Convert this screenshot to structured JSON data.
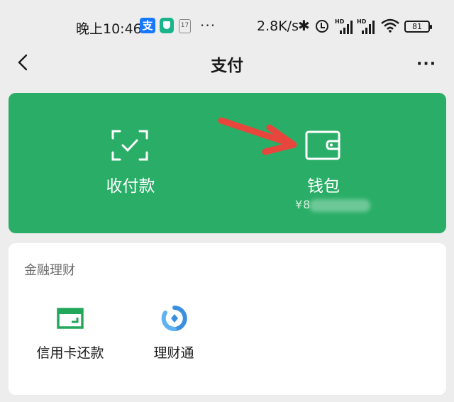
{
  "status_bar": {
    "time": "晚上10:46",
    "alipay_glyph": "支",
    "calendar_day": "17",
    "more_dots": "···",
    "net_speed": "2.8K/s",
    "bluetooth_glyph": "✱",
    "sim1_label": "HD",
    "sim2_label": "HD",
    "battery": "81",
    "icons": [
      "alipay-icon",
      "security-shield-icon",
      "calendar-icon",
      "bluetooth-icon",
      "alarm-icon",
      "signal-icon",
      "wifi-icon",
      "battery-icon"
    ]
  },
  "nav": {
    "back_glyph": "‹",
    "title": "支付",
    "more_glyph": "···"
  },
  "green_card": {
    "color": "#2aae67",
    "pay": {
      "label": "收付款",
      "icon": "scan-check-icon"
    },
    "wallet": {
      "label": "钱包",
      "icon": "wallet-icon",
      "balance_prefix": "¥8"
    }
  },
  "annotation": {
    "arrow_color": "#e8453c"
  },
  "finance": {
    "title": "金融理财",
    "items": [
      {
        "label": "信用卡还款",
        "icon": "credit-card-icon"
      },
      {
        "label": "理财通",
        "icon": "wealth-icon"
      }
    ]
  }
}
